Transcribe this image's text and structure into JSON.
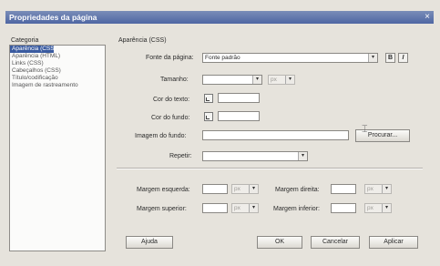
{
  "window": {
    "title": "Propriedades da página",
    "close": "×"
  },
  "sidebar": {
    "header": "Categoria",
    "items": [
      {
        "label": "Aparência (CSS)",
        "selected": true
      },
      {
        "label": "Aparência (HTML)"
      },
      {
        "label": "Links (CSS)"
      },
      {
        "label": "Cabeçalhos (CSS)"
      },
      {
        "label": "Título/codificação"
      },
      {
        "label": "Imagem de rastreamento"
      }
    ]
  },
  "panel": {
    "section_title": "Aparência (CSS)",
    "font_label": "Fonte da página:",
    "font_value": "Fonte padrão",
    "bold": "B",
    "italic": "I",
    "size_label": "Tamanho:",
    "size_unit": "px",
    "text_color_label": "Cor do texto:",
    "bg_color_label": "Cor do fundo:",
    "bg_image_label": "Imagem do fundo:",
    "browse_label": "Procurar...",
    "repeat_label": "Repetir:",
    "margins": {
      "left_label": "Margem esquerda:",
      "right_label": "Margem direita:",
      "top_label": "Margem superior:",
      "bottom_label": "Margem inferior:",
      "unit": "px"
    }
  },
  "footer": {
    "help": "Ajuda",
    "ok": "OK",
    "cancel": "Cancelar",
    "apply": "Aplicar"
  },
  "icons": {
    "arrow": "▾",
    "cursor": "⌶"
  }
}
